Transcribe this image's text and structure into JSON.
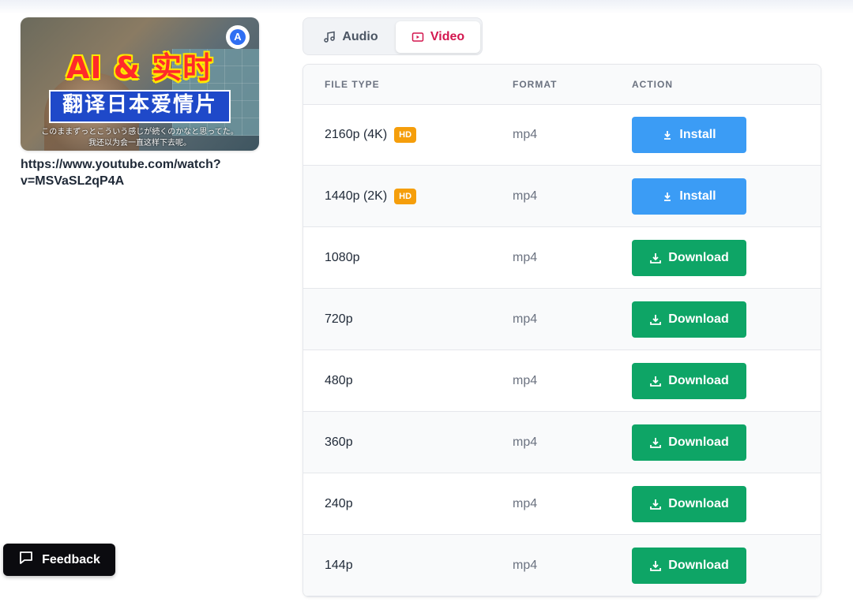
{
  "video": {
    "thumbnail": {
      "title_line1": "AI & 实时",
      "title_line2": "翻译日本爱情片",
      "subtitle_jp": "このままずっとこういう感じが続くのかなと思ってた。",
      "subtitle_cn": "我还以为会一直这样下去呢。",
      "badge_icon": "appsinc-logo-icon",
      "badge_letter": "A"
    },
    "url": "https://www.youtube.com/watch?v=MSVaSL2qP4A"
  },
  "tabs": [
    {
      "label": "Audio",
      "icon": "music-note-icon",
      "active": false
    },
    {
      "label": "Video",
      "icon": "video-icon",
      "active": true
    }
  ],
  "table": {
    "headers": {
      "file_type": "FILE TYPE",
      "format": "FORMAT",
      "action": "ACTION"
    },
    "rows": [
      {
        "file_type": "2160p (4K)",
        "badge": "HD",
        "format": "mp4",
        "action": "Install",
        "action_type": "install"
      },
      {
        "file_type": "1440p (2K)",
        "badge": "HD",
        "format": "mp4",
        "action": "Install",
        "action_type": "install"
      },
      {
        "file_type": "1080p",
        "badge": "",
        "format": "mp4",
        "action": "Download",
        "action_type": "download"
      },
      {
        "file_type": "720p",
        "badge": "",
        "format": "mp4",
        "action": "Download",
        "action_type": "download"
      },
      {
        "file_type": "480p",
        "badge": "",
        "format": "mp4",
        "action": "Download",
        "action_type": "download"
      },
      {
        "file_type": "360p",
        "badge": "",
        "format": "mp4",
        "action": "Download",
        "action_type": "download"
      },
      {
        "file_type": "240p",
        "badge": "",
        "format": "mp4",
        "action": "Download",
        "action_type": "download"
      },
      {
        "file_type": "144p",
        "badge": "",
        "format": "mp4",
        "action": "Download",
        "action_type": "download"
      }
    ]
  },
  "feedback": {
    "label": "Feedback",
    "icon": "chat-bubble-icon"
  },
  "colors": {
    "install": "#3b9cf5",
    "download": "#0ea566",
    "hd_badge": "#f59e0b",
    "active_tab": "#d3174f"
  }
}
